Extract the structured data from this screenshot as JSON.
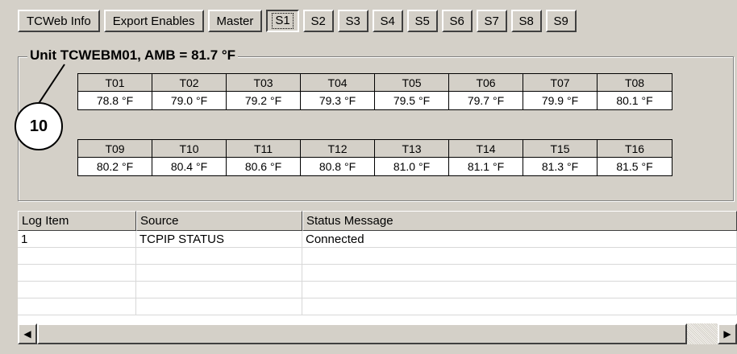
{
  "toolbar": {
    "buttons": [
      "TCWeb Info",
      "Export Enables",
      "Master"
    ],
    "stations": [
      "S1",
      "S2",
      "S3",
      "S4",
      "S5",
      "S6",
      "S7",
      "S8",
      "S9"
    ],
    "active_station": "S1"
  },
  "unit": {
    "title": "Unit TCWEBM01, AMB = 81.7 °F"
  },
  "temps_row1": {
    "headers": [
      "T01",
      "T02",
      "T03",
      "T04",
      "T05",
      "T06",
      "T07",
      "T08"
    ],
    "values": [
      "78.8 °F",
      "79.0 °F",
      "79.2 °F",
      "79.3 °F",
      "79.5 °F",
      "79.7 °F",
      "79.9 °F",
      "80.1 °F"
    ]
  },
  "temps_row2": {
    "headers": [
      "T09",
      "T10",
      "T11",
      "T12",
      "T13",
      "T14",
      "T15",
      "T16"
    ],
    "values": [
      "80.2 °F",
      "80.4 °F",
      "80.6 °F",
      "80.8 °F",
      "81.0 °F",
      "81.1 °F",
      "81.3 °F",
      "81.5 °F"
    ]
  },
  "callout": {
    "label": "10"
  },
  "log": {
    "columns": [
      "Log Item",
      "Source",
      "Status Message"
    ],
    "rows": [
      [
        "1",
        "TCPIP STATUS",
        "Connected"
      ],
      [
        "",
        "",
        ""
      ],
      [
        "",
        "",
        ""
      ],
      [
        "",
        "",
        ""
      ],
      [
        "",
        "",
        ""
      ]
    ]
  },
  "scrollbar": {
    "left_icon": "arrow-left-icon",
    "right_icon": "arrow-right-icon"
  }
}
